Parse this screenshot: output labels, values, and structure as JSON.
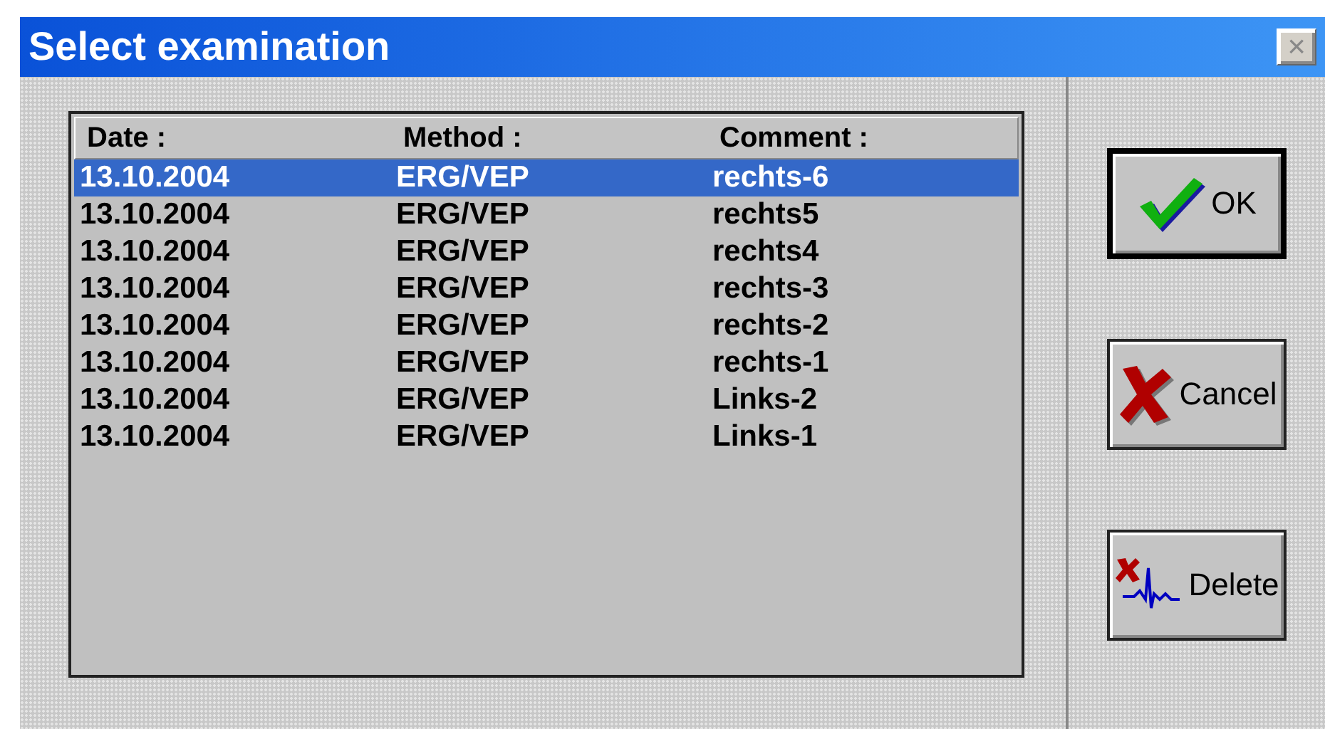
{
  "window": {
    "title": "Select examination",
    "close": "×"
  },
  "table": {
    "columns": [
      "Date :",
      "Method :",
      "Comment :"
    ],
    "rows": [
      {
        "date": "13.10.2004",
        "method": "ERG/VEP",
        "comment": "rechts-6",
        "selected": true
      },
      {
        "date": "13.10.2004",
        "method": "ERG/VEP",
        "comment": "rechts5",
        "selected": false
      },
      {
        "date": "13.10.2004",
        "method": "ERG/VEP",
        "comment": "rechts4",
        "selected": false
      },
      {
        "date": "13.10.2004",
        "method": "ERG/VEP",
        "comment": "rechts-3",
        "selected": false
      },
      {
        "date": "13.10.2004",
        "method": "ERG/VEP",
        "comment": "rechts-2",
        "selected": false
      },
      {
        "date": "13.10.2004",
        "method": "ERG/VEP",
        "comment": "rechts-1",
        "selected": false
      },
      {
        "date": "13.10.2004",
        "method": "ERG/VEP",
        "comment": "Links-2",
        "selected": false
      },
      {
        "date": "13.10.2004",
        "method": "ERG/VEP",
        "comment": "Links-1",
        "selected": false
      }
    ]
  },
  "buttons": [
    {
      "label": "OK",
      "kind": "ok",
      "default": true
    },
    {
      "label": "Cancel",
      "kind": "cancel",
      "default": false
    },
    {
      "label": "Delete",
      "kind": "delete",
      "default": false
    }
  ]
}
